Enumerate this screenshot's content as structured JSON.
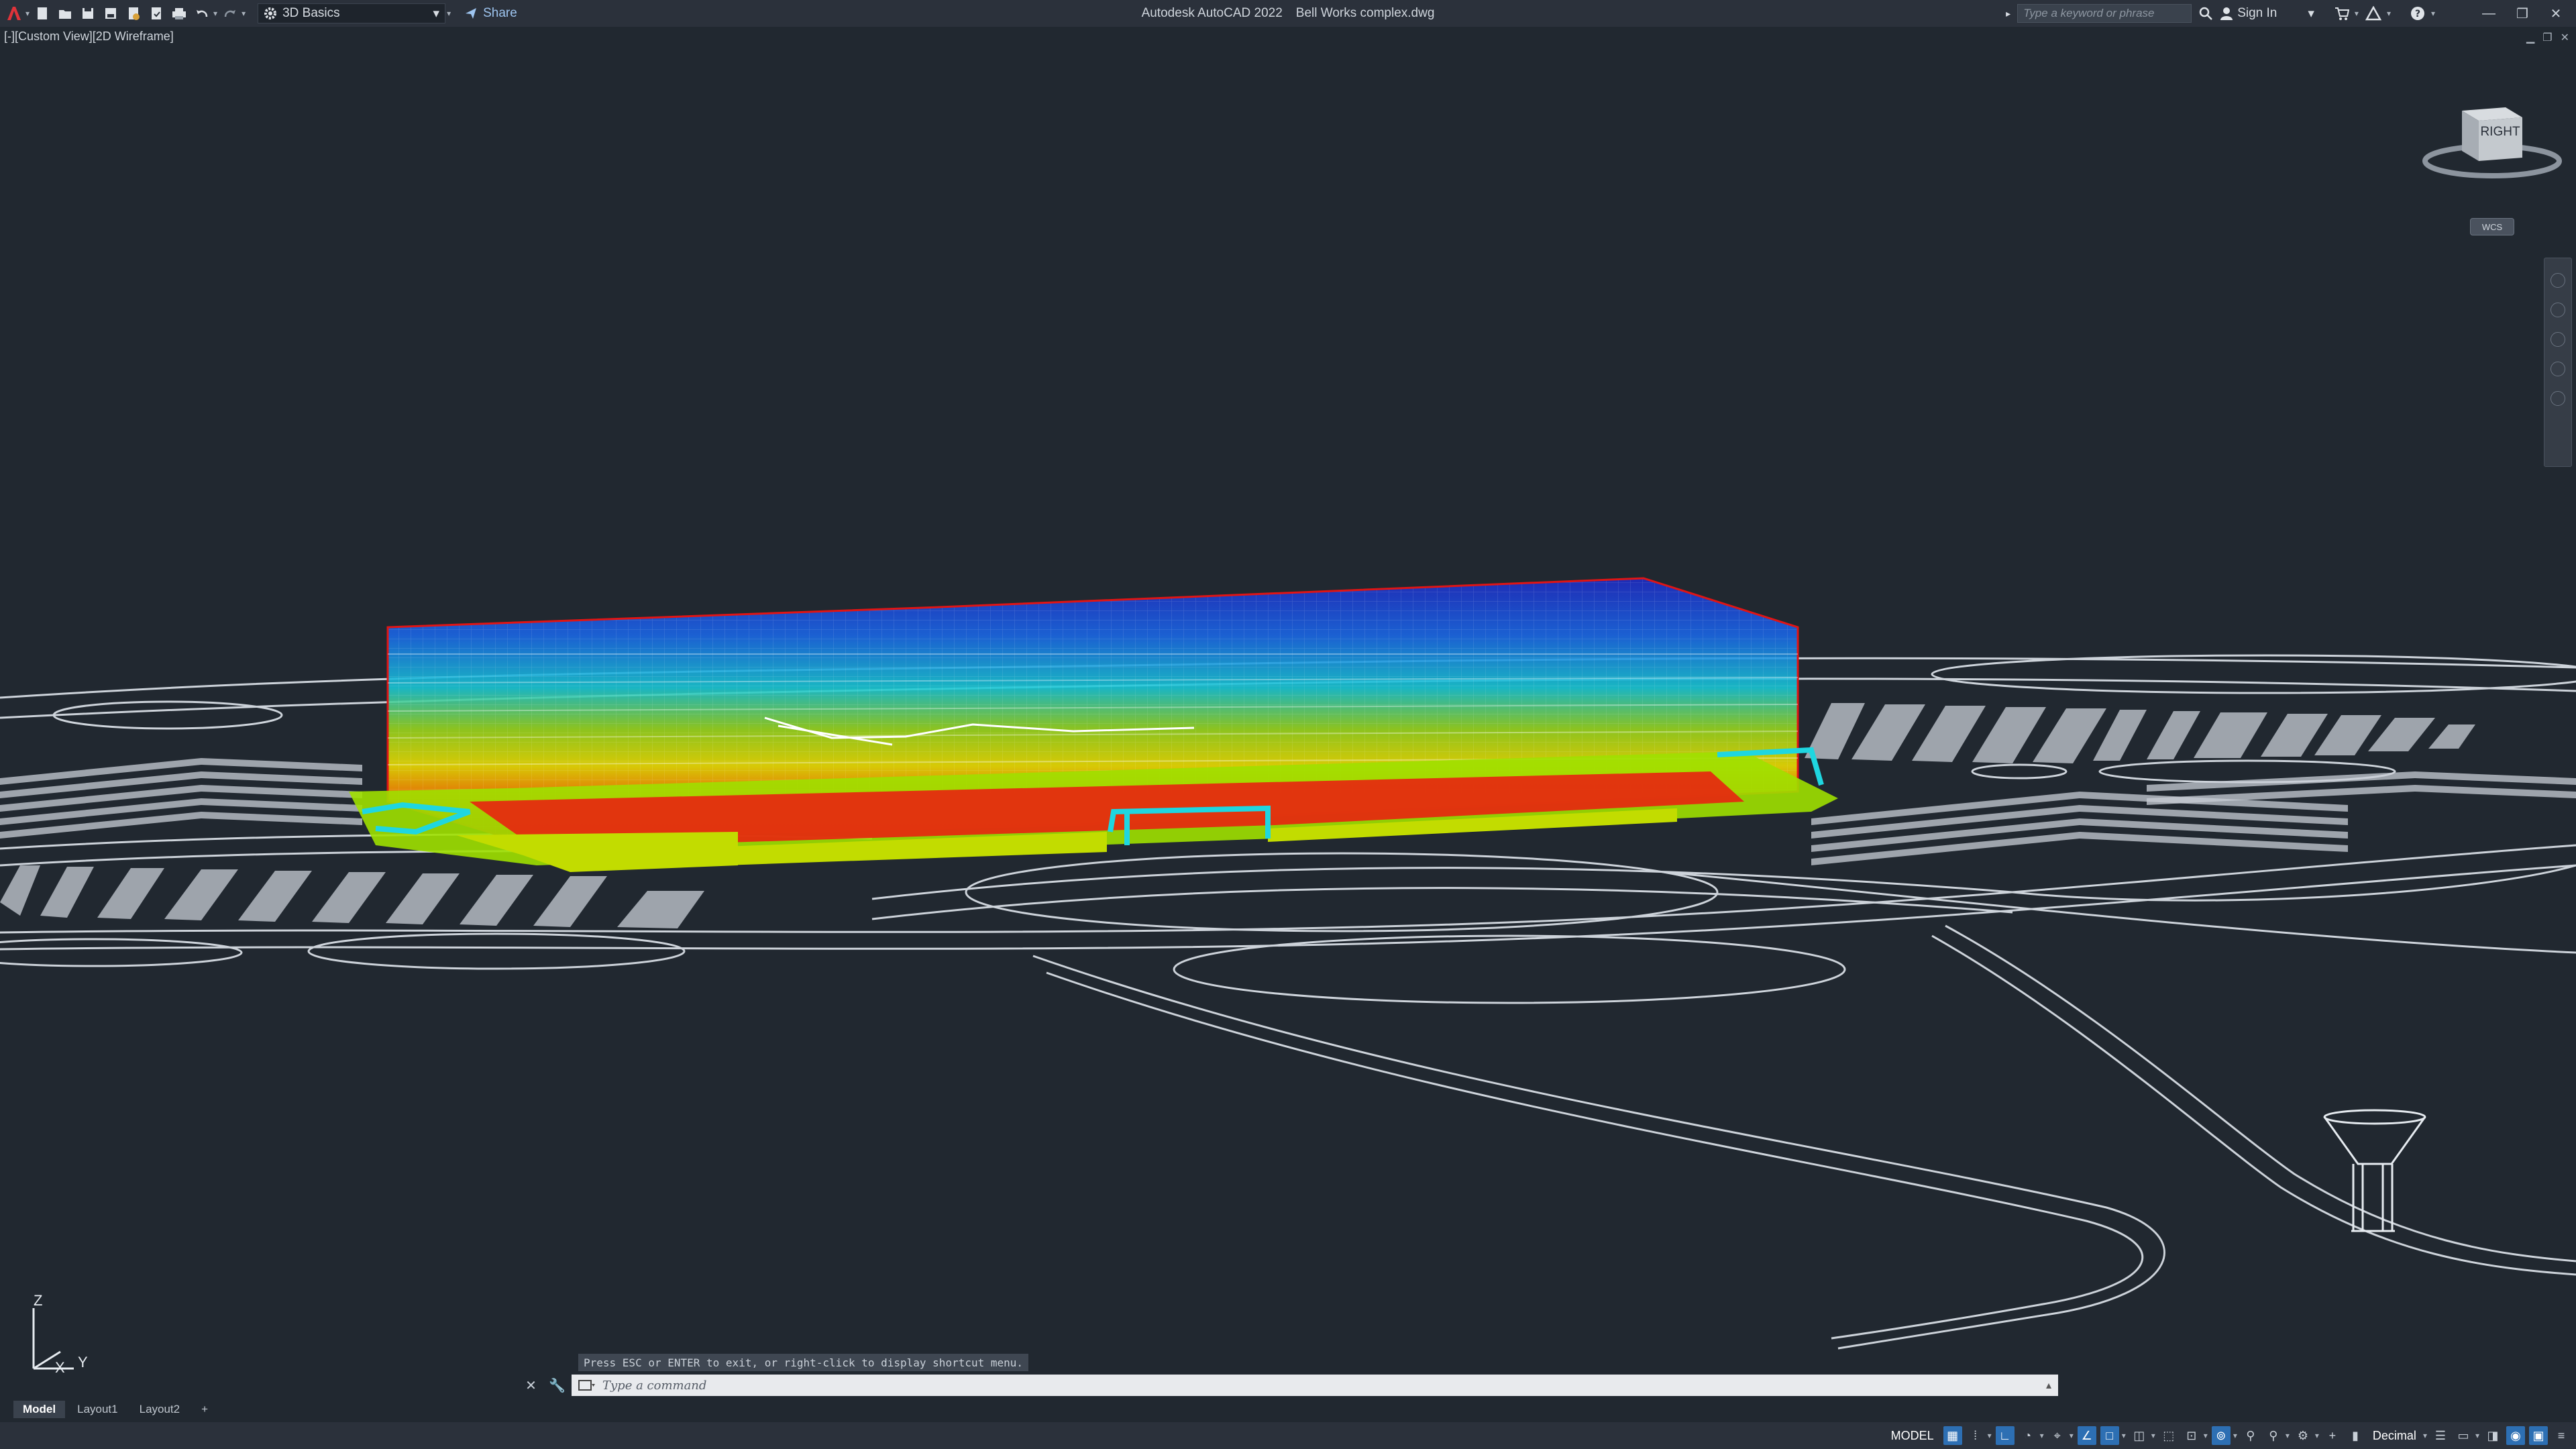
{
  "app": {
    "title": "Autodesk AutoCAD 2022",
    "document": "Bell Works complex.dwg"
  },
  "toolbar": {
    "workspace": "3D Basics",
    "share_label": "Share"
  },
  "search": {
    "placeholder": "Type a keyword or phrase"
  },
  "account": {
    "signin_label": "Sign In"
  },
  "viewport": {
    "label": "[-][Custom View][2D Wireframe]",
    "viewcube_face": "RIGHT",
    "wcs_label": "WCS",
    "ucs_z": "Z",
    "ucs_y": "Y",
    "ucs_x": "X"
  },
  "command": {
    "hint": "Press ESC or ENTER to exit, or right-click to display shortcut menu.",
    "placeholder": "Type a command"
  },
  "layout_tabs": [
    {
      "label": "Model",
      "active": true
    },
    {
      "label": "Layout1",
      "active": false
    },
    {
      "label": "Layout2",
      "active": false
    }
  ],
  "status": {
    "model_label": "MODEL",
    "units": "Decimal"
  },
  "colors": {
    "background": "#212830",
    "accent": "#2d6fb3"
  }
}
